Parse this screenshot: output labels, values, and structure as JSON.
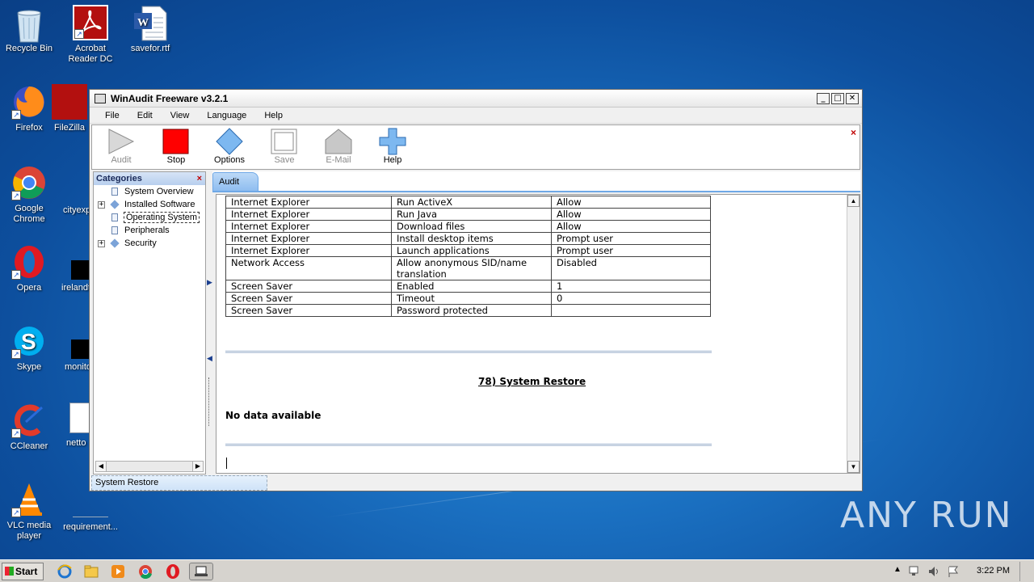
{
  "desktop": {
    "icons": [
      {
        "label": "Recycle Bin",
        "icon": "recycle-bin-icon"
      },
      {
        "label": "Acrobat Reader DC",
        "icon": "acrobat-icon"
      },
      {
        "label": "savefor.rtf",
        "icon": "word-document-icon"
      },
      {
        "label": "Firefox",
        "icon": "firefox-icon"
      },
      {
        "label": "FileZilla",
        "icon": "filezilla-icon"
      },
      {
        "label": "Google Chrome",
        "icon": "chrome-icon"
      },
      {
        "label": "cityexp",
        "icon": "file-icon"
      },
      {
        "label": "Opera",
        "icon": "opera-icon"
      },
      {
        "label": "irelandt",
        "icon": "file-icon"
      },
      {
        "label": "Skype",
        "icon": "skype-icon"
      },
      {
        "label": "monito",
        "icon": "file-icon"
      },
      {
        "label": "CCleaner",
        "icon": "ccleaner-icon"
      },
      {
        "label": "netto",
        "icon": "word-document-icon"
      },
      {
        "label": "VLC media player",
        "icon": "vlc-icon"
      },
      {
        "label": "requirement...",
        "icon": "file-icon"
      }
    ]
  },
  "window": {
    "title": "WinAudit Freeware v3.2.1",
    "controls": {
      "minimize": "_",
      "maximize": "□",
      "close": "✕"
    }
  },
  "menu": [
    "File",
    "Edit",
    "View",
    "Language",
    "Help"
  ],
  "toolbar": {
    "buttons": [
      {
        "label": "Audit",
        "enabled": false
      },
      {
        "label": "Stop",
        "enabled": true
      },
      {
        "label": "Options",
        "enabled": true
      },
      {
        "label": "Save",
        "enabled": false
      },
      {
        "label": "E-Mail",
        "enabled": false
      },
      {
        "label": "Help",
        "enabled": true
      }
    ],
    "close": "×"
  },
  "categories": {
    "title": "Categories",
    "close": "×",
    "items": [
      {
        "label": "System Overview",
        "expandable": false,
        "icon": "document-icon"
      },
      {
        "label": "Installed Software",
        "expandable": true,
        "icon": "diamond-icon"
      },
      {
        "label": "Operating System",
        "expandable": false,
        "icon": "document-icon",
        "selected": true
      },
      {
        "label": "Peripherals",
        "expandable": false,
        "icon": "document-icon"
      },
      {
        "label": "Security",
        "expandable": true,
        "icon": "diamond-icon"
      }
    ]
  },
  "tabs": [
    "Audit"
  ],
  "report": {
    "rows": [
      [
        "Internet Explorer",
        "Run ActiveX",
        "Allow"
      ],
      [
        "Internet Explorer",
        "Run Java",
        "Allow"
      ],
      [
        "Internet Explorer",
        "Download files",
        "Allow"
      ],
      [
        "Internet Explorer",
        "Install desktop items",
        "Prompt user"
      ],
      [
        "Internet Explorer",
        "Launch applications",
        "Prompt user"
      ],
      [
        "Network Access",
        "Allow anonymous SID/name translation",
        "Disabled"
      ],
      [
        "Screen Saver",
        "Enabled",
        "1"
      ],
      [
        "Screen Saver",
        "Timeout",
        "0"
      ],
      [
        "Screen Saver",
        "Password protected",
        ""
      ]
    ],
    "section_title": "78) System Restore",
    "no_data": "No data available"
  },
  "status": {
    "text": "System Restore"
  },
  "taskbar": {
    "start": "Start",
    "clock": "3:22 PM",
    "apps": [
      "ie-icon",
      "explorer-icon",
      "media-player-icon",
      "chrome-icon",
      "opera-icon",
      "winaudit-icon"
    ]
  },
  "watermark": "ANY RUN"
}
